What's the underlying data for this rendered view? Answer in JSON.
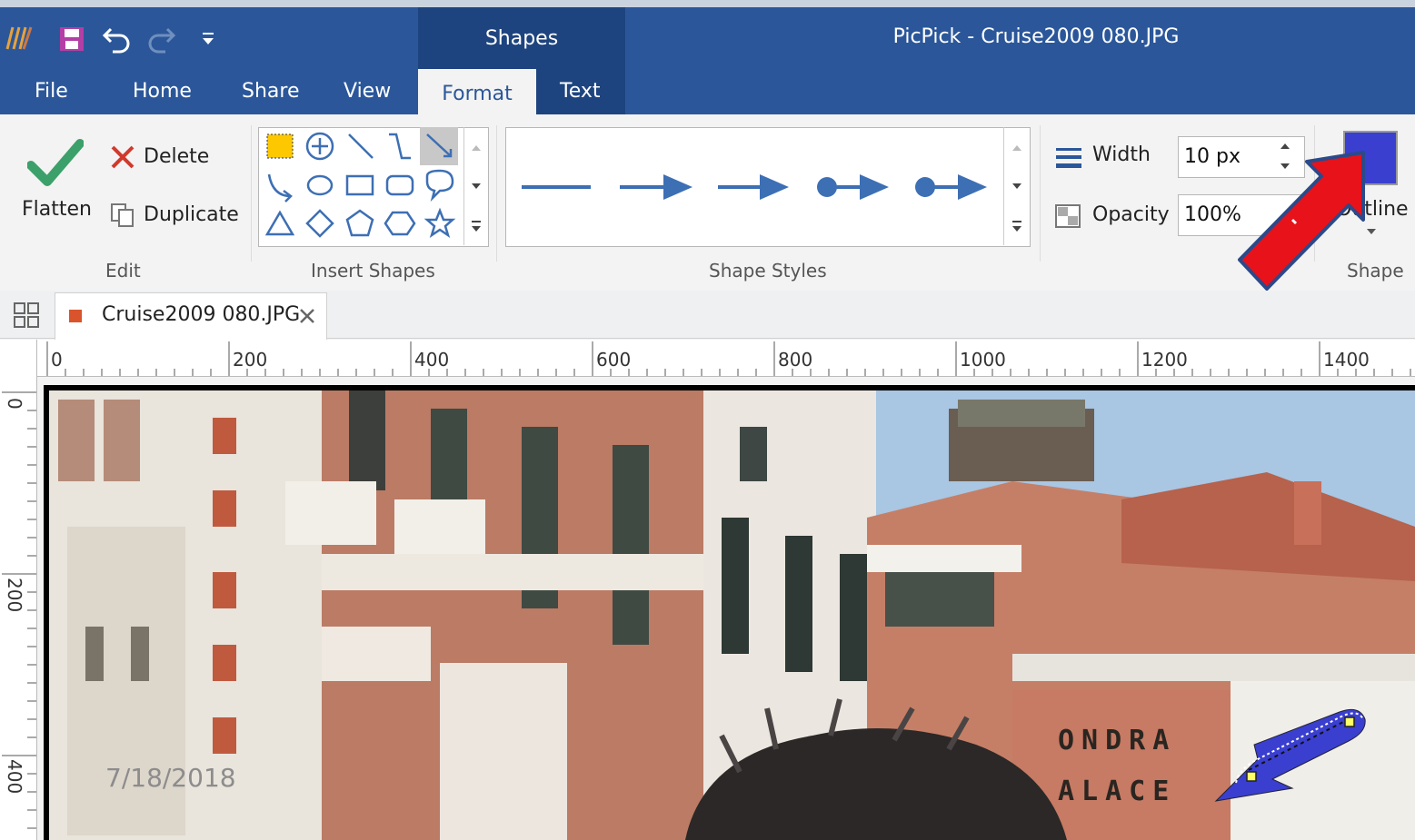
{
  "window": {
    "title": "PicPick - Cruise2009 080.JPG",
    "context_tab": "Shapes"
  },
  "menu": {
    "file": "File",
    "home": "Home",
    "share": "Share",
    "view": "View",
    "format": "Format",
    "text": "Text"
  },
  "edit_group": {
    "flatten": "Flatten",
    "delete": "Delete",
    "duplicate": "Duplicate",
    "label": "Edit"
  },
  "insert_shapes": {
    "label": "Insert Shapes"
  },
  "shape_styles": {
    "label": "Shape Styles"
  },
  "format_group": {
    "width_label": "Width",
    "width_value": "10 px",
    "opacity_label": "Opacity",
    "opacity_value": "100%",
    "outline_label": "Outline",
    "shape_label": "Shape"
  },
  "colors": {
    "title_bar": "#2b579a",
    "context_tab": "#1e447f",
    "accent_shape": "#3a3fcf",
    "callout_arrow": "#e8121a",
    "style_blue": "#3d6fb4"
  },
  "document": {
    "tab_name": "Cruise2009 080.JPG"
  },
  "ruler": {
    "h_ticks": [
      "0",
      "200",
      "400",
      "600",
      "800",
      "1000",
      "1200",
      "1400"
    ],
    "v_ticks": [
      "0",
      "200",
      "400"
    ]
  },
  "overlay": {
    "date": "7/18/2018",
    "sign_line1": "ONDRA",
    "sign_line2": "ALACE"
  }
}
